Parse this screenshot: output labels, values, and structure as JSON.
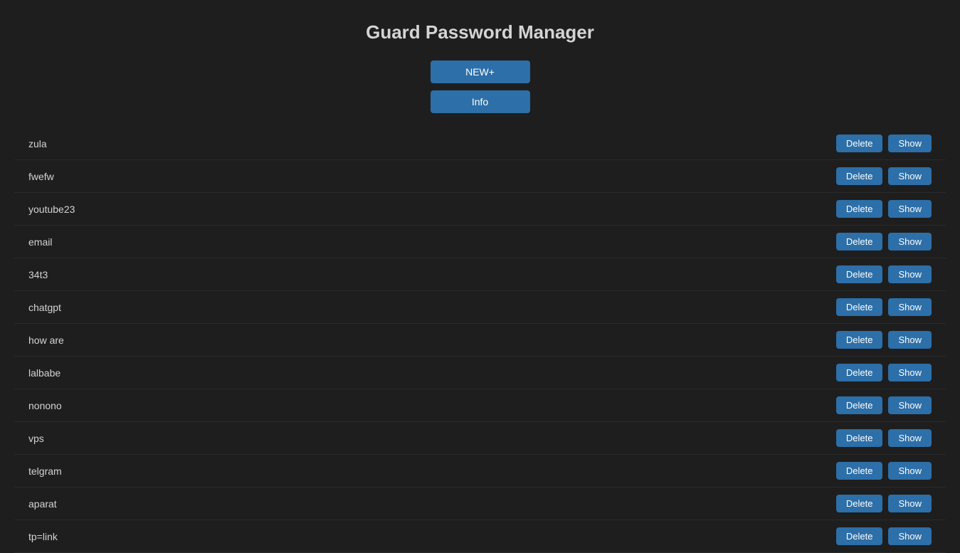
{
  "app": {
    "title": "Guard Password Manager"
  },
  "buttons": {
    "new_label": "NEW+",
    "info_label": "Info",
    "delete_label": "Delete",
    "show_label": "Show"
  },
  "entries": [
    {
      "id": 1,
      "name": "zula"
    },
    {
      "id": 2,
      "name": "fwefw"
    },
    {
      "id": 3,
      "name": "youtube23"
    },
    {
      "id": 4,
      "name": "email"
    },
    {
      "id": 5,
      "name": "34t3"
    },
    {
      "id": 6,
      "name": "chatgpt"
    },
    {
      "id": 7,
      "name": "how are"
    },
    {
      "id": 8,
      "name": "lalbabe"
    },
    {
      "id": 9,
      "name": "nonono"
    },
    {
      "id": 10,
      "name": "vps"
    },
    {
      "id": 11,
      "name": "telgram"
    },
    {
      "id": 12,
      "name": "aparat"
    },
    {
      "id": 13,
      "name": "tp=link"
    }
  ]
}
